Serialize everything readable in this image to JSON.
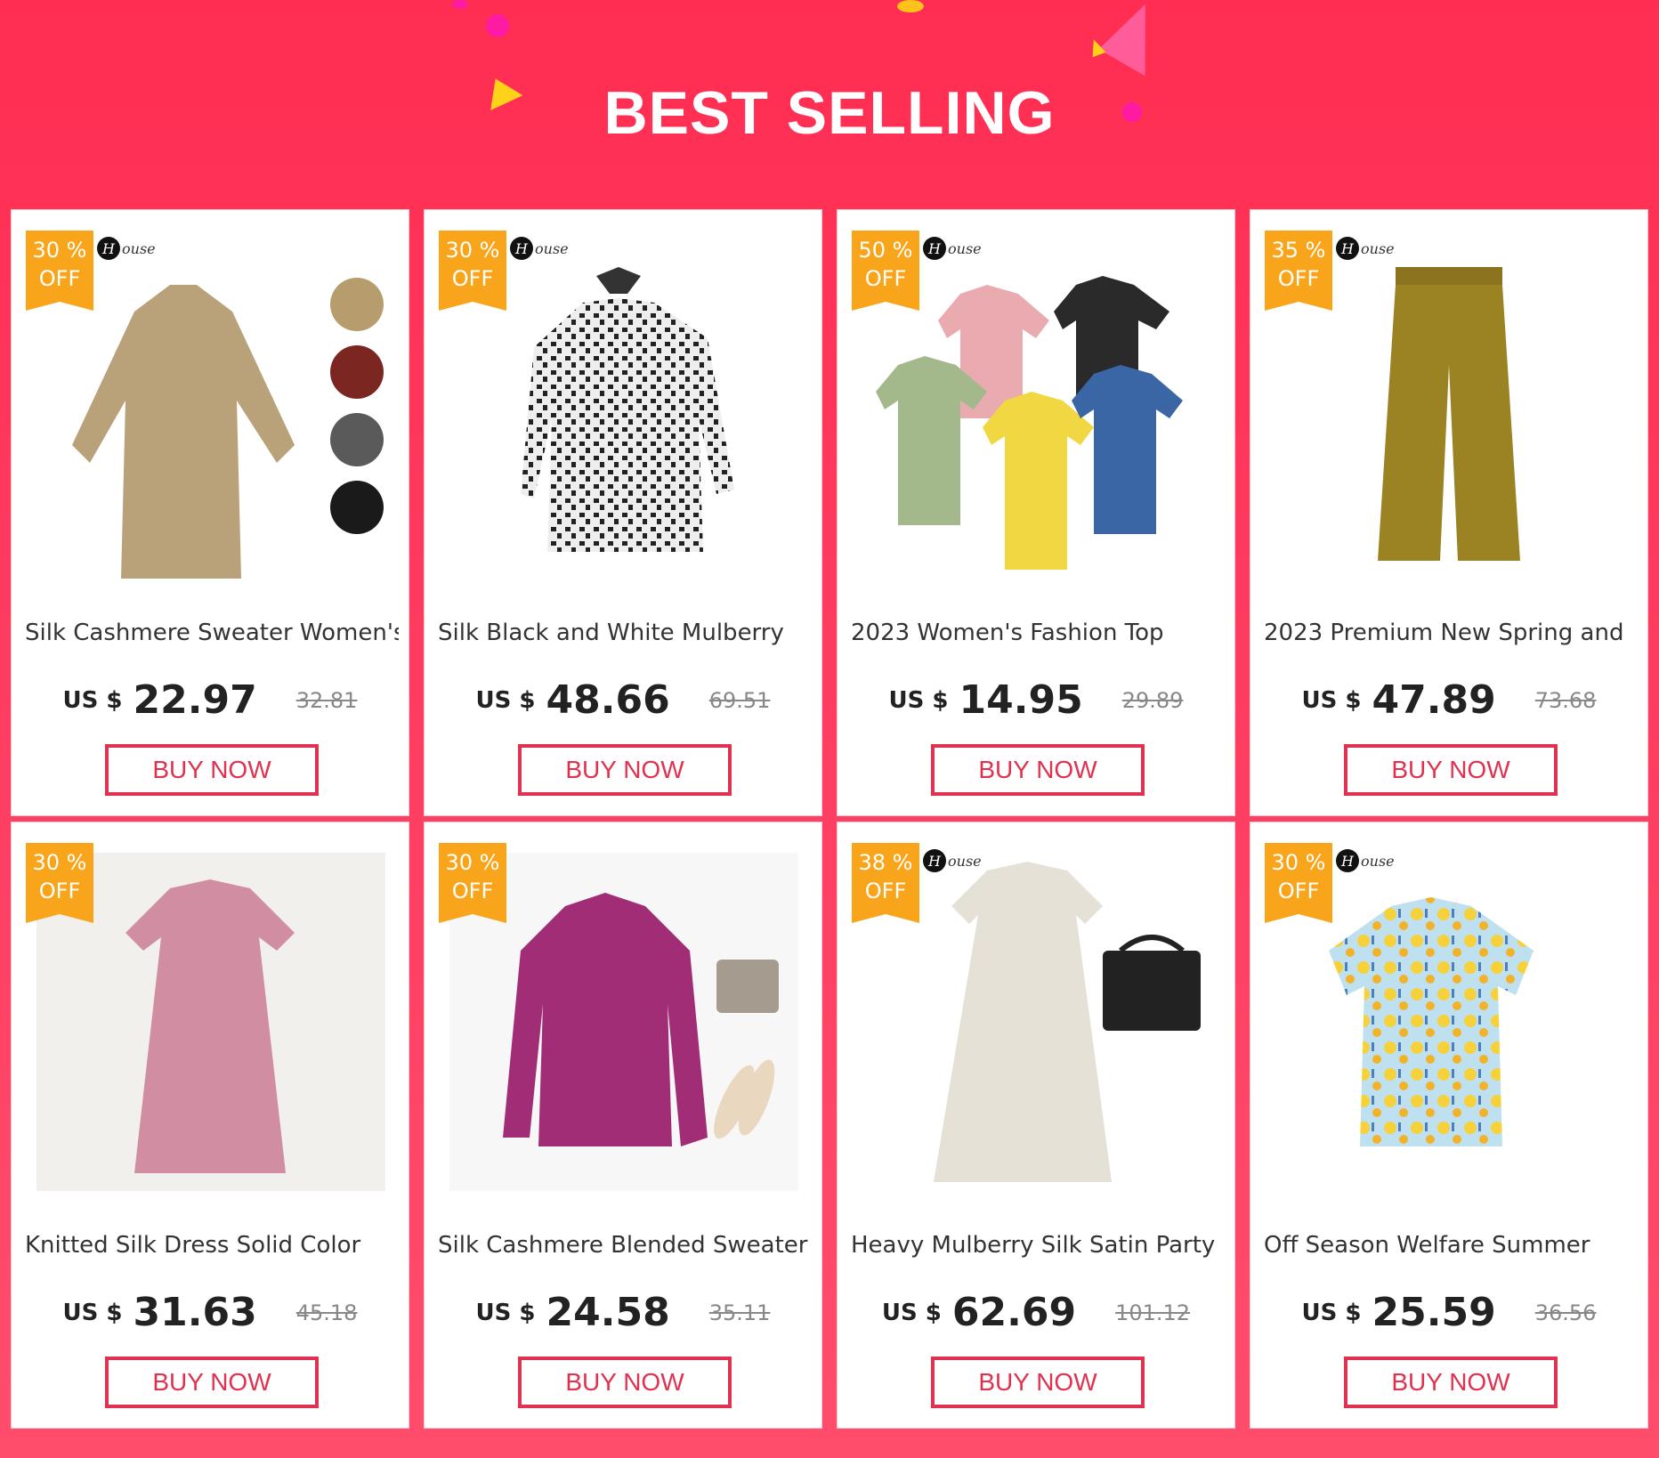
{
  "banner": {
    "title": "BEST SELLING"
  },
  "colors": {
    "banner": "#ff2d52",
    "badge": "#f9a51b",
    "buy_button": "#e0314f",
    "confetti": "#ff1aa3"
  },
  "brand": {
    "mark": "H",
    "text": "ouse"
  },
  "products": [
    {
      "discount": "30 %",
      "off": "OFF",
      "title": "Silk Cashmere Sweater Women's",
      "currency": "US $",
      "price": "22.97",
      "old_price": "32.81",
      "buy": "BUY NOW",
      "image": "beige-sweater",
      "brand": true
    },
    {
      "discount": "30 %",
      "off": "OFF",
      "title": "Silk Black and White Mulberry",
      "currency": "US $",
      "price": "48.66",
      "old_price": "69.51",
      "buy": "BUY NOW",
      "image": "printed-shirt",
      "brand": true
    },
    {
      "discount": "50 %",
      "off": "OFF",
      "title": "2023 Women's Fashion Top",
      "currency": "US $",
      "price": "14.95",
      "old_price": "29.89",
      "buy": "BUY NOW",
      "image": "tshirts-set",
      "brand": true
    },
    {
      "discount": "35 %",
      "off": "OFF",
      "title": "2023 Premium New Spring and",
      "currency": "US $",
      "price": "47.89",
      "old_price": "73.68",
      "buy": "BUY NOW",
      "image": "velvet-pants",
      "brand": true
    },
    {
      "discount": "30 %",
      "off": "OFF",
      "title": "Knitted Silk Dress Solid Color",
      "currency": "US $",
      "price": "31.63",
      "old_price": "45.18",
      "buy": "BUY NOW",
      "image": "pink-dress",
      "brand": false
    },
    {
      "discount": "30 %",
      "off": "OFF",
      "title": "Silk Cashmere Blended Sweater",
      "currency": "US $",
      "price": "24.58",
      "old_price": "35.11",
      "buy": "BUY NOW",
      "image": "magenta-sweater",
      "brand": false
    },
    {
      "discount": "38 %",
      "off": "OFF",
      "title": "Heavy Mulberry Silk Satin Party",
      "currency": "US $",
      "price": "62.69",
      "old_price": "101.12",
      "buy": "BUY NOW",
      "image": "satin-dress",
      "brand": true
    },
    {
      "discount": "30 %",
      "off": "OFF",
      "title": "Off Season Welfare Summer",
      "currency": "US $",
      "price": "25.59",
      "old_price": "36.56",
      "buy": "BUY NOW",
      "image": "floral-top",
      "brand": true
    }
  ]
}
